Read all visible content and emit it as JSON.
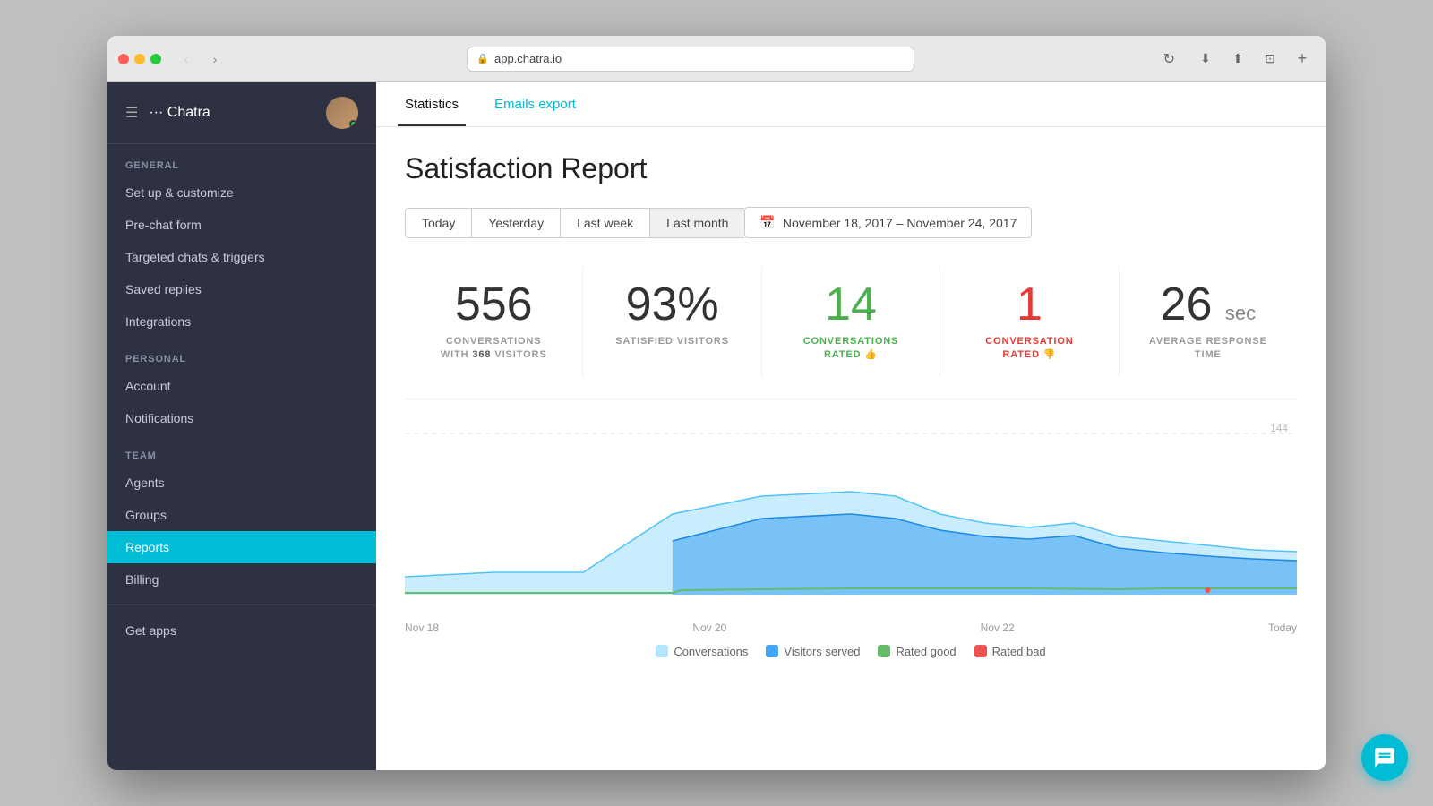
{
  "browser": {
    "url": "app.chatra.io",
    "reload_label": "↻"
  },
  "sidebar": {
    "app_name": "Chatra",
    "sections": {
      "general_label": "GENERAL",
      "personal_label": "PERSONAL",
      "team_label": "TEAM"
    },
    "general_items": [
      {
        "label": "Set up & customize",
        "active": false
      },
      {
        "label": "Pre-chat form",
        "active": false
      },
      {
        "label": "Targeted chats & triggers",
        "active": false
      },
      {
        "label": "Saved replies",
        "active": false
      },
      {
        "label": "Integrations",
        "active": false
      }
    ],
    "personal_items": [
      {
        "label": "Account",
        "active": false
      },
      {
        "label": "Notifications",
        "active": false
      }
    ],
    "team_items": [
      {
        "label": "Agents",
        "active": false
      },
      {
        "label": "Groups",
        "active": false
      },
      {
        "label": "Reports",
        "active": true
      },
      {
        "label": "Billing",
        "active": false
      }
    ],
    "bottom_items": [
      {
        "label": "Get apps",
        "active": false
      }
    ]
  },
  "tabs": [
    {
      "label": "Statistics",
      "active": true
    },
    {
      "label": "Emails export",
      "active": false
    }
  ],
  "page": {
    "title": "Satisfaction Report",
    "filters": [
      "Today",
      "Yesterday",
      "Last week",
      "Last month"
    ],
    "active_filter": "Last month",
    "date_range": "November 18, 2017 – November 24, 2017"
  },
  "stats": [
    {
      "number": "556",
      "label_line1": "CONVERSATIONS",
      "label_line2": "WITH",
      "label_bold": "368",
      "label_line3": "VISITORS",
      "color": "default"
    },
    {
      "number": "93%",
      "label_line1": "SATISFIED VISITORS",
      "color": "default"
    },
    {
      "number": "14",
      "label_line1": "CONVERSATIONS",
      "label_line2": "RATED 👍",
      "color": "green"
    },
    {
      "number": "1",
      "label_line1": "CONVERSATION",
      "label_line2": "RATED 👎",
      "color": "red"
    },
    {
      "number": "26",
      "unit": "sec",
      "label_line1": "AVERAGE RESPONSE",
      "label_line2": "TIME",
      "color": "default"
    }
  ],
  "chart": {
    "y_max_label": "144",
    "x_labels": [
      "Nov 18",
      "Nov 20",
      "Nov 22",
      "Today"
    ]
  },
  "legend": [
    {
      "label": "Conversations",
      "color": "#b3e5fc"
    },
    {
      "label": "Visitors served",
      "color": "#42a5f5"
    },
    {
      "label": "Rated good",
      "color": "#66bb6a"
    },
    {
      "label": "Rated bad",
      "color": "#ef5350"
    }
  ]
}
